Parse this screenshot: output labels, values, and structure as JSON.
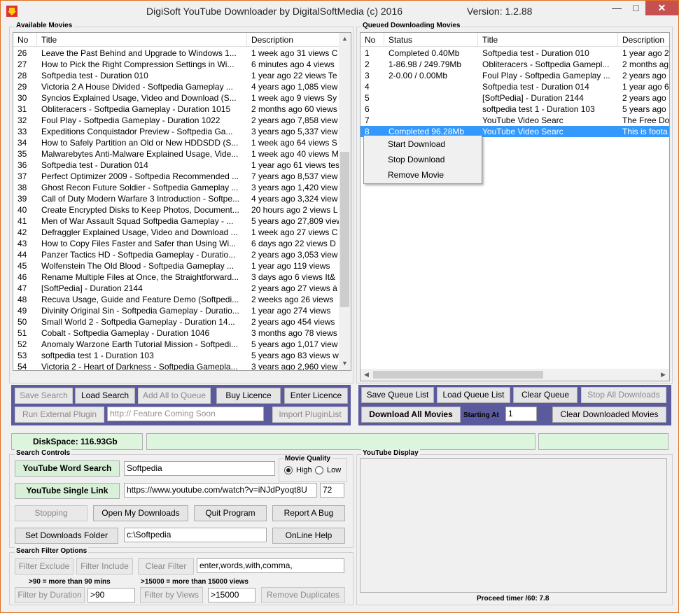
{
  "window": {
    "title": "DigiSoft YouTube Downloader by DigitalSoftMedia (c) 2016",
    "version": "Version: 1.2.88",
    "minimize": "—",
    "maximize": "□",
    "close": "✕"
  },
  "available": {
    "group_title": "Available Movies",
    "columns": [
      "No",
      "Title",
      "Description"
    ],
    "rows": [
      [
        "26",
        "Leave the Past Behind and Upgrade to Windows 1...",
        "1 week ago 31 views C"
      ],
      [
        "27",
        "How to Pick the Right Compression Settings in Wi...",
        "6 minutes ago 4 views"
      ],
      [
        "28",
        "Softpedia test  - Duration 010",
        "1 year ago 22 views Te"
      ],
      [
        "29",
        "Victoria 2 A House Divided - Softpedia Gameplay  ...",
        "4 years ago 1,085 view"
      ],
      [
        "30",
        "Syncios Explained Usage, Video and Download (S...",
        "1 week ago 9 views Sy"
      ],
      [
        "31",
        "Obliteracers - Softpedia Gameplay  - Duration 1015",
        "2 months ago 60 views"
      ],
      [
        "32",
        "Foul Play - Softpedia Gameplay  - Duration 1022",
        "2 years ago 7,858 view"
      ],
      [
        "33",
        "Expeditions Conquistador Preview - Softpedia Ga...",
        "3 years ago 5,337 view"
      ],
      [
        "34",
        "How to Safely Partition an Old or New HDDSDD (S...",
        "1 week ago 64 views S"
      ],
      [
        "35",
        "Malwarebytes Anti-Malware Explained Usage, Vide...",
        "1 week ago 40 views M"
      ],
      [
        "36",
        "Softpedia test  - Duration 014",
        "1 year ago 61 views tes"
      ],
      [
        "37",
        "Perfect Optimizer 2009 - Softpedia Recommended ...",
        "7 years ago 8,537 view"
      ],
      [
        "38",
        "Ghost Recon Future Soldier - Softpedia Gameplay  ...",
        "3 years ago 1,420 view"
      ],
      [
        "39",
        "Call of Duty Modern Warfare 3 Introduction - Softpe...",
        "4 years ago 3,324 view"
      ],
      [
        "40",
        "Create Encrypted Disks to Keep Photos, Document...",
        "20 hours ago 2 views L"
      ],
      [
        "41",
        "Men of War Assault Squad Softpedia Gameplay  - ...",
        "5 years ago 27,809 view"
      ],
      [
        "42",
        "Defraggler Explained Usage, Video and Download ...",
        "1 week ago 27 views C"
      ],
      [
        "43",
        "How to Copy Files Faster and Safer than Using Wi...",
        "6 days ago 22 views D"
      ],
      [
        "44",
        "Panzer Tactics HD - Softpedia Gameplay  - Duratio...",
        "2 years ago 3,053 view"
      ],
      [
        "45",
        "Wolfenstein The Old Blood - Softpedia Gameplay  ...",
        "1 year ago 119 views"
      ],
      [
        "46",
        "Rename Multiple Files at Once, the Straightforward...",
        "3 days ago 6 views It&"
      ],
      [
        "47",
        " [SoftPedia]  - Duration 2144",
        "2 years ago 27 views á"
      ],
      [
        "48",
        "Recuva Usage, Guide and Feature Demo (Softpedi...",
        "2 weeks ago 26 views"
      ],
      [
        "49",
        "Divinity Original Sin - Softpedia Gameplay  - Duratio...",
        "1 year ago 274 views"
      ],
      [
        "50",
        "Small World 2 - Softpedia Gameplay  - Duration 14...",
        "2 years ago 454 views"
      ],
      [
        "51",
        "Cobalt - Softpedia Gameplay  - Duration 1046",
        "3 months ago 78 views"
      ],
      [
        "52",
        "Anomaly Warzone Earth Tutorial Mission - Softpedi...",
        "5 years ago 1,017 view"
      ],
      [
        "53",
        "softpedia test 1  - Duration 103",
        "5 years ago 83 views w"
      ],
      [
        "54",
        "Victoria 2 - Heart of Darkness - Softpedia Gamepla...",
        "3 years ago 2,960 view"
      ]
    ]
  },
  "queued": {
    "group_title": "Queued Downloading Movies",
    "columns": [
      "No",
      "Status",
      "Title",
      "Description"
    ],
    "rows": [
      [
        "1",
        "Completed 0.40Mb",
        "Softpedia test  - Duration 010",
        "1 year ago 2"
      ],
      [
        "2",
        "1-86.98 / 249.79Mb",
        "Obliteracers - Softpedia Gamepl...",
        "2 months ag"
      ],
      [
        "3",
        "2-0.00 / 0.00Mb",
        "Foul Play - Softpedia Gameplay  ...",
        "2 years ago"
      ],
      [
        "4",
        "",
        "Softpedia test  - Duration 014",
        "1 year ago 6"
      ],
      [
        "5",
        "",
        " [SoftPedia]  - Duration 2144",
        "2 years ago"
      ],
      [
        "6",
        "",
        "softpedia test 1  - Duration 103",
        "5 years ago"
      ],
      [
        "7",
        "",
        "YouTube Video Searc",
        "The Free Do"
      ],
      [
        "8",
        "Completed 96.28Mb",
        "YouTube Video Searc",
        "This is foota"
      ]
    ],
    "selected_row": 7
  },
  "context_menu": {
    "items": [
      "Start Download",
      "Stop Download",
      "Remove Movie"
    ]
  },
  "left_buttons": {
    "save_search": "Save Search",
    "load_search": "Load Search",
    "add_all": "Add All to Queue",
    "buy_licence": "Buy Licence",
    "enter_licence": "Enter Licence",
    "run_plugin": "Run External Plugin",
    "plugin_placeholder": "http:// Feature Coming Soon",
    "import_plugin": "Import PluginList"
  },
  "right_buttons": {
    "save_queue": "Save Queue List",
    "load_queue": "Load Queue List",
    "clear_queue": "Clear Queue",
    "stop_all": "Stop All Downloads",
    "download_all": "Download All Movies",
    "starting_at_label": "Starting At",
    "starting_at_value": "1",
    "clear_downloaded": "Clear Downloaded Movies"
  },
  "diskspace": "DiskSpace: 116.93Gb",
  "search_controls": {
    "group_title": "Search Controls",
    "word_search_btn": "YouTube Word Search",
    "word_search_value": "Softpedia",
    "single_link_btn": "YouTube Single Link",
    "single_link_value": "https://www.youtube.com/watch?v=iNJdPyoqt8U",
    "single_link_num": "72",
    "quality_title": "Movie Quality",
    "quality_high": "High",
    "quality_low": "Low",
    "stopping": "Stopping",
    "open_downloads": "Open My Downloads",
    "quit": "Quit Program",
    "report_bug": "Report A Bug",
    "set_folder": "Set Downloads Folder",
    "folder_value": "c:\\Softpedia",
    "online_help": "OnLine Help"
  },
  "filter": {
    "group_title": "Search Filter Options",
    "filter_exclude": "Filter Exclude",
    "filter_include": "Filter Include",
    "clear_filter": "Clear Filter",
    "words_value": "enter,words,with,comma,",
    "duration_hint": ">90 = more than 90 mins",
    "views_hint": ">15000 = more than 15000 views",
    "filter_duration": "Filter by Duration",
    "duration_value": ">90",
    "filter_views": "Filter by Views",
    "views_value": ">15000",
    "remove_dupes": "Remove Duplicates"
  },
  "youtube_display": {
    "group_title": "YouTube Display",
    "timer": "Proceed timer /60: 7.8"
  }
}
